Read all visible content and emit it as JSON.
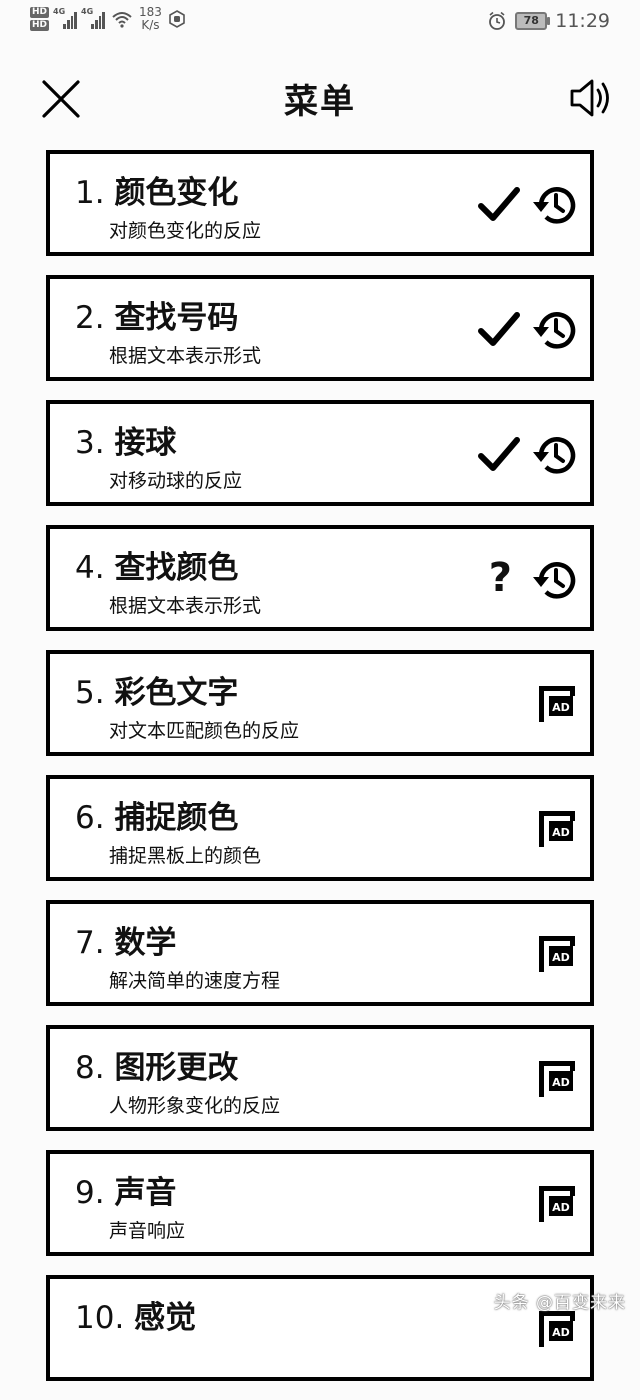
{
  "status_bar": {
    "hd1": "HD",
    "hd2": "HD",
    "net1": "4G",
    "net2": "4G",
    "speed_value": "183",
    "speed_unit": "K/s",
    "battery": "78",
    "time": "11:29"
  },
  "header": {
    "title": "菜单",
    "close_icon": "close-icon",
    "sound_icon": "speaker-icon"
  },
  "menu": {
    "items": [
      {
        "number": "1.",
        "title": "颜色变化",
        "subtitle": "对颜色变化的反应",
        "state": "done"
      },
      {
        "number": "2.",
        "title": "查找号码",
        "subtitle": "根据文本表示形式",
        "state": "done"
      },
      {
        "number": "3.",
        "title": "接球",
        "subtitle": "对移动球的反应",
        "state": "done"
      },
      {
        "number": "4.",
        "title": "查找颜色",
        "subtitle": "根据文本表示形式",
        "state": "unknown",
        "qmark": "?"
      },
      {
        "number": "5.",
        "title": "彩色文字",
        "subtitle": "对文本匹配颜色的反应",
        "state": "ad"
      },
      {
        "number": "6.",
        "title": "捕捉颜色",
        "subtitle": "捕捉黑板上的颜色",
        "state": "ad"
      },
      {
        "number": "7.",
        "title": "数学",
        "subtitle": "解决简单的速度方程",
        "state": "ad"
      },
      {
        "number": "8.",
        "title": "图形更改",
        "subtitle": "人物形象变化的反应",
        "state": "ad"
      },
      {
        "number": "9.",
        "title": "声音",
        "subtitle": "声音响应",
        "state": "ad"
      },
      {
        "number": "10.",
        "title": "感觉",
        "subtitle": "",
        "state": "ad"
      }
    ]
  },
  "ad_label": "AD",
  "watermark": "头条 @百变来来"
}
